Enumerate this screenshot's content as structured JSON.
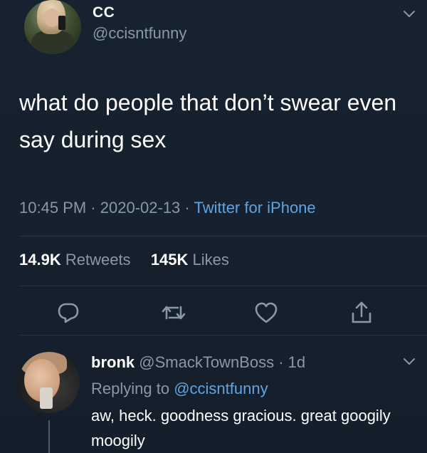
{
  "tweet": {
    "display_name": "CC",
    "handle": "@ccisntfunny",
    "text": "what do people that don’t swear even say during sex",
    "time": "10:45 PM",
    "date": "2020-02-13",
    "separator": "·",
    "source": "Twitter for iPhone",
    "retweets_count": "14.9K",
    "retweets_label": "Retweets",
    "likes_count": "145K",
    "likes_label": "Likes"
  },
  "actions": {
    "reply_icon": "reply-icon",
    "retweet_icon": "retweet-icon",
    "like_icon": "heart-icon",
    "share_icon": "share-icon"
  },
  "reply": {
    "display_name": "bronk",
    "handle": "@SmackTownBoss",
    "separator": "·",
    "age": "1d",
    "replying_label": "Replying to",
    "replying_to": "@ccisntfunny",
    "text": "aw, heck. goodness gracious. great googily moogily"
  },
  "colors": {
    "background": "#15202b",
    "secondary_text": "#8899a6",
    "accent": "#5fa4e3"
  }
}
